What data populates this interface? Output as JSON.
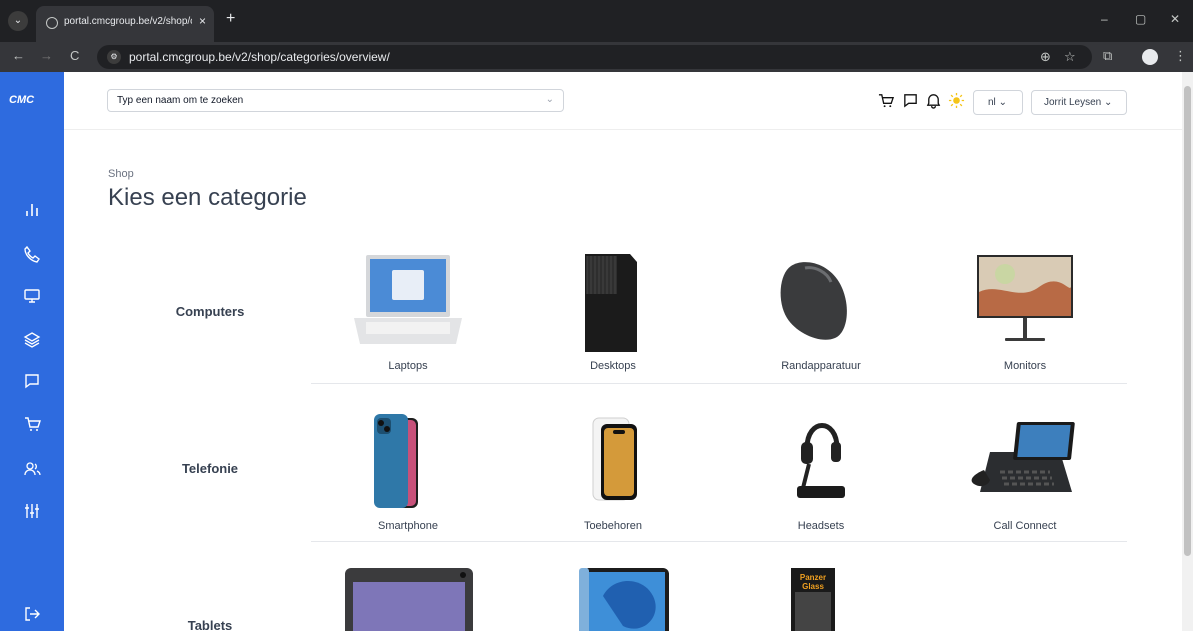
{
  "browser": {
    "tab_title": "portal.cmcgroup.be/v2/shop/c",
    "tab_close": "×",
    "new_tab": "+",
    "url": "portal.cmcgroup.be/v2/shop/categories/overview/",
    "window_controls": [
      "–",
      "▢",
      "✕"
    ]
  },
  "sidebar": {
    "logo": "CMC",
    "items": [
      "chart-icon",
      "phone-icon",
      "monitor-icon",
      "layers-icon",
      "chat-icon",
      "cart-icon",
      "users-icon",
      "sliders-icon",
      "logout-icon"
    ]
  },
  "header": {
    "search_placeholder": "Typ een naam om te zoeken",
    "language": "nl",
    "user": "Jorrit Leysen"
  },
  "main": {
    "breadcrumb": "Shop",
    "title": "Kies een categorie",
    "categories": [
      {
        "name": "Computers",
        "items": [
          "Laptops",
          "Desktops",
          "Randapparatuur",
          "Monitors"
        ]
      },
      {
        "name": "Telefonie",
        "items": [
          "Smartphone",
          "Toebehoren",
          "Headsets",
          "Call Connect"
        ]
      },
      {
        "name": "Tablets",
        "items": [
          "",
          "",
          ""
        ]
      }
    ],
    "panzer_text": "Panzer Glass"
  },
  "colors": {
    "sidebar": "#2e6bdf",
    "accent_sun": "#f5c518"
  }
}
